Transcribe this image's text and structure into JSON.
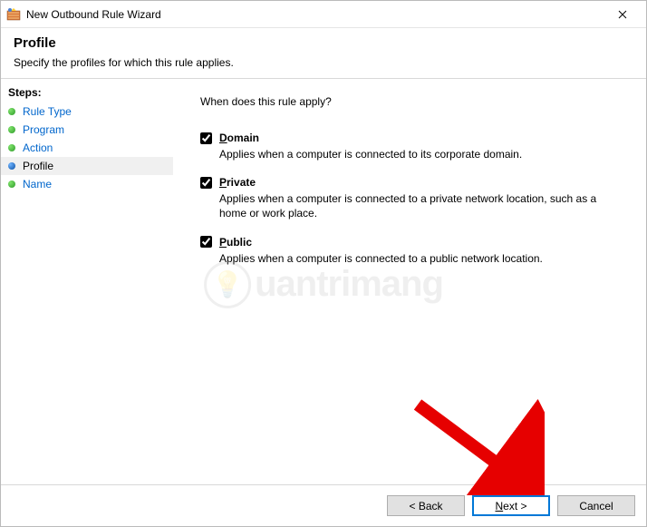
{
  "window": {
    "title": "New Outbound Rule Wizard"
  },
  "header": {
    "title": "Profile",
    "description": "Specify the profiles for which this rule applies."
  },
  "sidebar": {
    "heading": "Steps:",
    "items": [
      {
        "label": "Rule Type",
        "state": "done"
      },
      {
        "label": "Program",
        "state": "done"
      },
      {
        "label": "Action",
        "state": "done"
      },
      {
        "label": "Profile",
        "state": "current"
      },
      {
        "label": "Name",
        "state": "pending"
      }
    ]
  },
  "content": {
    "question": "When does this rule apply?",
    "options": [
      {
        "label_prefix": "D",
        "label_rest": "omain",
        "checked": true,
        "description": "Applies when a computer is connected to its corporate domain."
      },
      {
        "label_prefix": "P",
        "label_rest": "rivate",
        "checked": true,
        "description": "Applies when a computer is connected to a private network location, such as a home or work place."
      },
      {
        "label_prefix": "P",
        "label_rest": "ublic",
        "checked": true,
        "description": "Applies when a computer is connected to a public network location."
      }
    ]
  },
  "footer": {
    "back": "< Back",
    "next": "Next >",
    "cancel": "Cancel"
  },
  "watermark": {
    "text": "uantrimang"
  }
}
